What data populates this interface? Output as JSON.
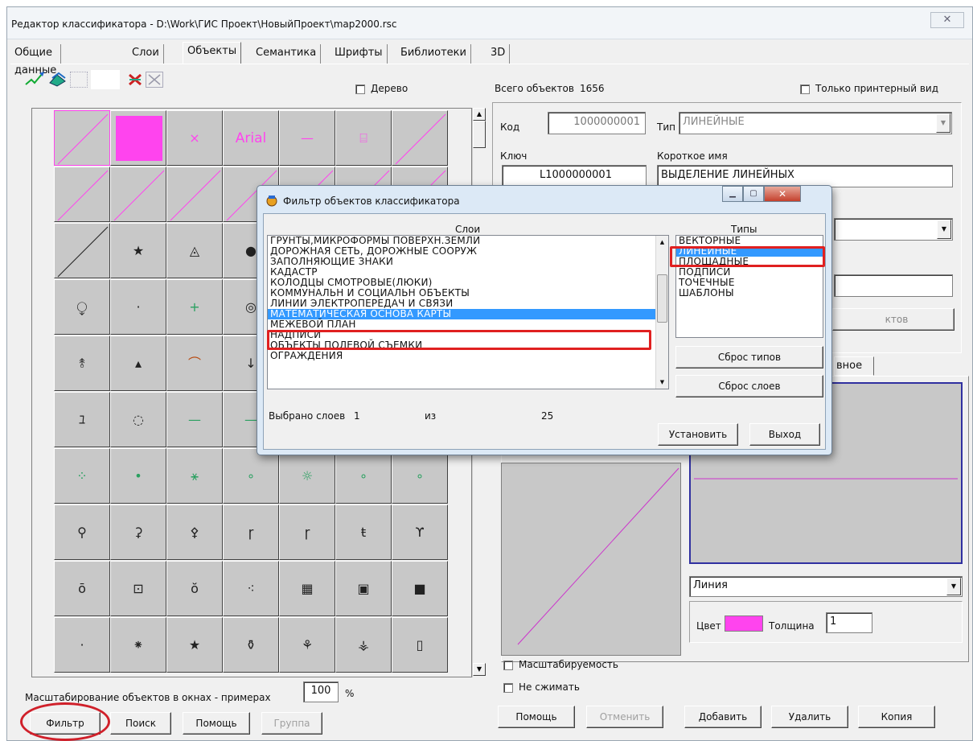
{
  "window": {
    "title": "Редактор классификатора - D:\\Work\\ГИС Проект\\НовыйПроект\\map2000.rsc",
    "close_glyph": "☒"
  },
  "tabs": [
    "Общие данные",
    "Слои",
    "Объекты",
    "Семантика",
    "Шрифты",
    "Библиотеки",
    "3D"
  ],
  "active_tab": "Объекты",
  "left": {
    "tree_label": "Дерево",
    "scale_label": "Масштабирование объектов в окнах - примерах",
    "scale_value": "100",
    "scale_unit": "%",
    "buttons": {
      "filter": "Фильтр",
      "search": "Поиск",
      "help": "Помощь",
      "group": "Группа"
    },
    "highlight_color": "#d0202a",
    "grid_glyphs": [
      [
        "",
        "",
        "×",
        "Arial",
        "—",
        "⌸",
        ""
      ],
      [
        "",
        "",
        "",
        "",
        "",
        "",
        ""
      ],
      [
        "",
        "★",
        "◬",
        "●",
        "",
        "",
        ""
      ],
      [
        "⧬",
        "·",
        "+",
        "◎",
        "",
        "",
        ""
      ],
      [
        "⥉",
        "▴",
        "⌒",
        "↓",
        "",
        "",
        ""
      ],
      [
        "ﾕ",
        "◌",
        "—",
        "—",
        "",
        "",
        ""
      ],
      [
        "⁘",
        "•",
        "⚹",
        "∘",
        "☼",
        "∘",
        "∘"
      ],
      [
        "⚲",
        "⚳",
        "⚴",
        "ɼ",
        "ɼ",
        "ŧ",
        "ϒ"
      ],
      [
        "ō",
        "⊡",
        "ŏ",
        "⁖",
        "▦",
        "▣",
        "■"
      ],
      [
        "·",
        "⁕",
        "★",
        "⚱",
        "⚘",
        "⚶",
        "▯"
      ]
    ]
  },
  "right": {
    "total_label": "Всего объектов",
    "total_value": "1656",
    "printer_label": "Только принтерный вид",
    "code_label": "Код",
    "code_value": "1000000001",
    "type_label": "Тип",
    "type_value": "ЛИНЕЙНЫЕ",
    "key_label": "Ключ",
    "key_value": "L1000000001",
    "short_name_label": "Короткое имя",
    "short_name_value": "ВЫДЕЛЕНИЕ ЛИНЕЙНЫХ",
    "partial_button": "ктов",
    "partial_tab": "вное",
    "line_kind": "Линия",
    "color_label": "Цвет",
    "color_value": "#ff44ee",
    "thickness_label": "Толщина",
    "thickness_value": "1",
    "scalable_label": "Масштабируемость",
    "nocompress_label": "Не сжимать",
    "buttons": {
      "help": "Помощь",
      "cancel": "Отменить",
      "add": "Добавить",
      "delete": "Удалить",
      "copy": "Копия"
    }
  },
  "dialog": {
    "title": "Фильтр объектов классификатора",
    "layers_header": "Слои",
    "types_header": "Типы",
    "layers": [
      "ГРУНТЫ,МИКРОФОРМЫ ПОВЕРХН.ЗЕМЛИ",
      "ДОРОЖНАЯ СЕТЬ, ДОРОЖНЫЕ СООРУЖ",
      "ЗАПОЛНЯЮЩИЕ ЗНАКИ",
      "КАДАСТР",
      "КОЛОДЦЫ СМОТРОВЫЕ(ЛЮКИ)",
      "КОММУНАЛЬН И СОЦИАЛЬН ОБЪЕКТЫ",
      "ЛИНИИ ЭЛЕКТРОПЕРЕДАЧ И СВЯЗИ",
      "МАТЕМАТИЧЕСКАЯ ОСНОВА КАРТЫ",
      "МЕЖЕВОЙ ПЛАН",
      "НАДПИСИ",
      "ОБЪЕКТЫ ПОЛЕВОЙ СЪЕМКИ",
      "ОГРАЖДЕНИЯ"
    ],
    "selected_layer": "МАТЕМАТИЧЕСКАЯ ОСНОВА КАРТЫ",
    "types": [
      "ВЕКТОРНЫЕ",
      "ЛИНЕЙНЫЕ",
      "ПЛОЩАДНЫЕ",
      "ПОДПИСИ",
      "ТОЧЕЧНЫЕ",
      "ШАБЛОНЫ"
    ],
    "selected_type": "ЛИНЕЙНЫЕ",
    "selected_count_label": "Выбрано слоев",
    "selected_count": "1",
    "of_label": "из",
    "total_layers": "25",
    "buttons": {
      "reset_types": "Сброс типов",
      "reset_layers": "Сброс слоев",
      "apply": "Установить",
      "exit": "Выход"
    }
  }
}
